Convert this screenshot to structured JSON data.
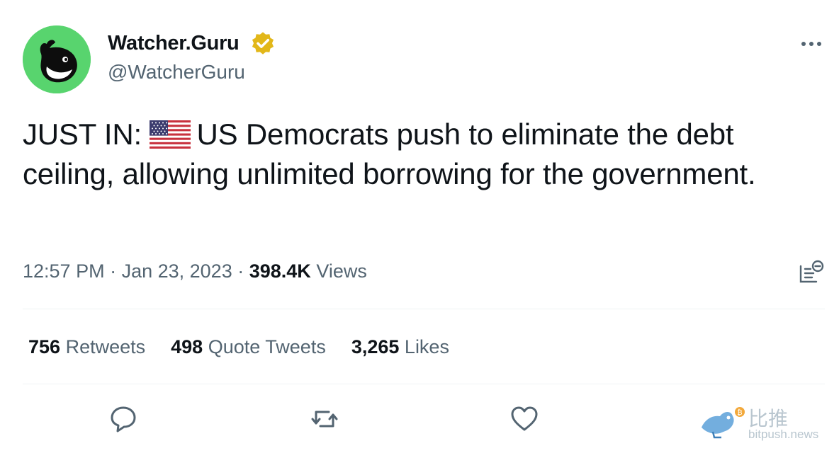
{
  "author": {
    "display_name": "Watcher.Guru",
    "handle": "@WatcherGuru",
    "verified": true,
    "avatar_icon": "whale-logo-icon",
    "avatar_bg": "#58d46e"
  },
  "tweet": {
    "text_prefix": "JUST IN:",
    "emoji": "us-flag-icon",
    "text_body": "US Democrats push to eliminate the debt ceiling, allowing unlimited borrowing for the government."
  },
  "meta": {
    "time": "12:57 PM",
    "separator1": " · ",
    "date": "Jan 23, 2023",
    "separator2": " · ",
    "views_count": "398.4K",
    "views_label": "Views"
  },
  "stats": {
    "retweets_count": "756",
    "retweets_label": "Retweets",
    "quotes_count": "498",
    "quotes_label": "Quote Tweets",
    "likes_count": "3,265",
    "likes_label": "Likes"
  },
  "watermark": {
    "cn": "比推",
    "en": "bitpush.news"
  },
  "colors": {
    "text": "#0f1419",
    "secondary": "#536471",
    "verified_gold": "#e2b719",
    "divider": "#eff3f4"
  }
}
